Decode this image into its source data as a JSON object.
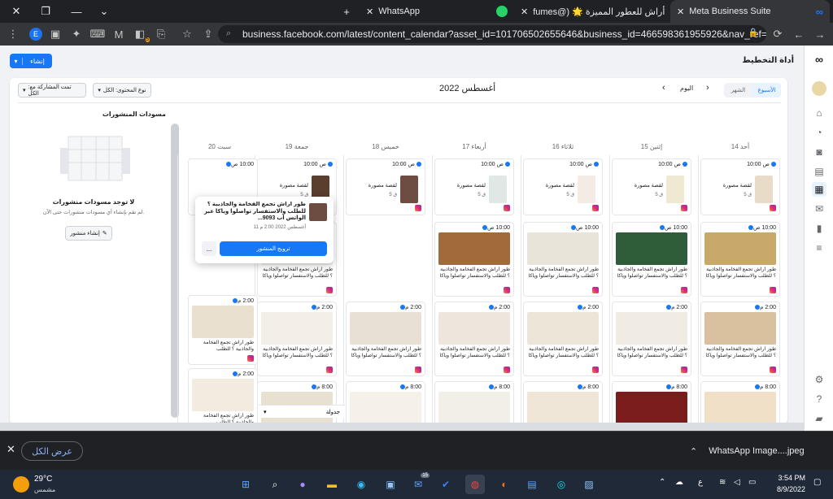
{
  "browser": {
    "tabs": [
      {
        "title": "WhatsApp",
        "color": "#25d366"
      },
      {
        "title": "fumes@) 🌟 أراش للعطور المميزة",
        "color": "#dd2a7b"
      },
      {
        "title": "Meta Business Suite",
        "color": "#1877f2"
      }
    ],
    "new_tab_glyph": "+",
    "url": "business.facebook.com/latest/content_calendar?asset_id=101706502655646&business_id=466598361955926&nav_ref=pa...",
    "profile_letter": "E",
    "extension_badge": "5"
  },
  "page": {
    "header_title": "أداة التخطيط",
    "create_button": "إنشاء",
    "view_week": "الأسبوع",
    "view_month": "الشهر",
    "today_button": "اليوم",
    "month_title": "أغسطس 2022",
    "filter_content": "نوع المحتوى: الكل",
    "filter_shared": "تمت المشاركة مع: الكل",
    "drafts_title": "مسودات المنشورات",
    "no_drafts_title": "لا توجد مسودات منشورات",
    "no_drafts_desc": "لم تقم بإنشاء أي مسودات منشورات حتى الآن.",
    "create_post": "إنشاء منشور",
    "days": [
      "أحد 14",
      "إثنين 15",
      "ثلاثاء 16",
      "أربعاء 17",
      "خميس 18",
      "جمعة 19",
      "سبت 20"
    ],
    "mini_label": "لقصة مصورة",
    "mini_sub": "5 ق",
    "time_10am": "10:00 ص",
    "time_2pm": "2:00 م",
    "time_8pm": "8:00 م",
    "caption": "طور أراش تجمع الفخامة والجاذبية ؟ للطلب والاستفسار تواصلوا وياكا عبر...",
    "popup_caption": "طور أراش تجمع الفخامة والجاذبية ؟ للطلب والاستفسار تواصلوا وياكا عبر الواتس اب 9093...",
    "popup_date": "11 أغسطس 2022 2:00 م",
    "popup_boost": "ترويج المنشور",
    "popup_more": "...",
    "table_toggle": "جدولة"
  },
  "downloads": {
    "close": "✕",
    "show_all": "عرض الكل",
    "file": "WhatsApp Image....jpeg"
  },
  "taskbar": {
    "temp": "29°C",
    "weather": "مشمس",
    "lang": "ع",
    "time": "3:54 PM",
    "date": "8/9/2022",
    "badge": "15"
  }
}
